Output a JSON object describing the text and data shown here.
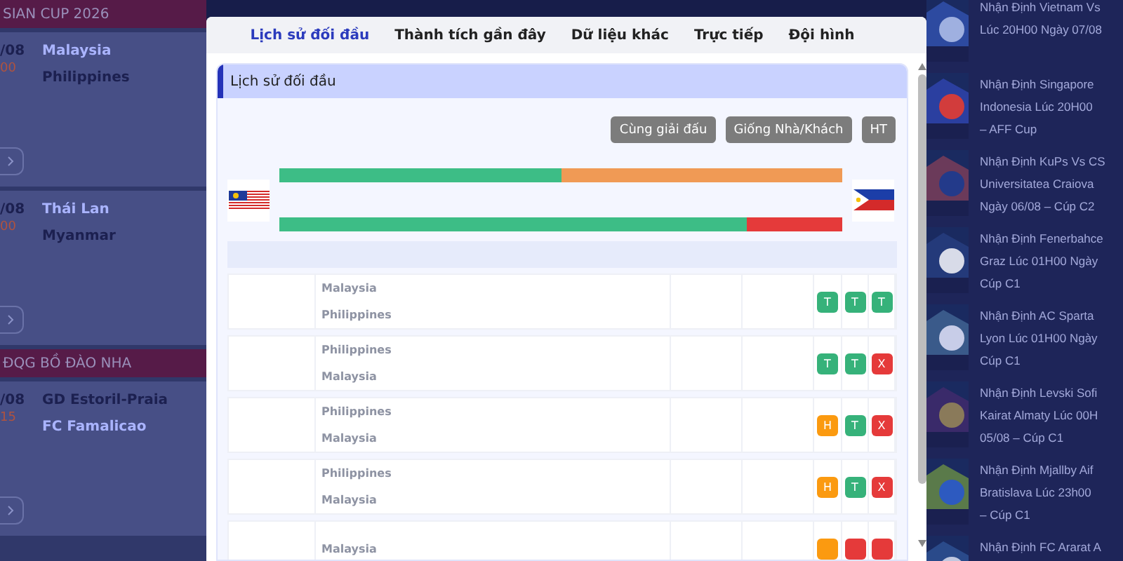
{
  "left_list": [
    {
      "heading": "SIAN CUP 2026",
      "matches": [
        {
          "date": "/08",
          "time": "00",
          "teams": [
            {
              "name": "Malaysia",
              "highlighted": true
            },
            {
              "name": "Philippines",
              "highlighted": false
            }
          ]
        },
        {
          "date": "/08",
          "time": "00",
          "teams": [
            {
              "name": "Thái Lan",
              "highlighted": true
            },
            {
              "name": "Myanmar",
              "highlighted": false
            }
          ]
        }
      ]
    },
    {
      "heading": "ĐQG BỒ ĐÀO NHA",
      "matches": [
        {
          "date": "/08",
          "time": "15",
          "teams": [
            {
              "name": "GD Estoril-Praia",
              "highlighted": false
            },
            {
              "name": "FC Famalicao",
              "highlighted": true
            }
          ]
        }
      ]
    }
  ],
  "modal": {
    "tabs": [
      {
        "label": "Lịch sử đối đầu",
        "selected": true
      },
      {
        "label": "Thành tích gần đây",
        "selected": false
      },
      {
        "label": "Dữ liệu khác",
        "selected": false
      },
      {
        "label": "Trực tiếp",
        "selected": false
      },
      {
        "label": "Đội hình",
        "selected": false
      }
    ],
    "section_title": "Lịch sử đối đầu",
    "filters": [
      "Cùng giải đấu",
      "Giống Nhà/Khách",
      "HT"
    ],
    "bars": [
      {
        "level": 0.5,
        "color": "#3dbd86",
        "rest": {
          "color": "#f09a55"
        }
      },
      {
        "level": 0.83,
        "color": "#3dbd86",
        "rest": {
          "color": "#e53a3a"
        }
      }
    ],
    "rows": [
      {
        "teams": [
          "Malaysia",
          "Philippines"
        ],
        "results": [
          {
            "text": "T",
            "color": "#36b27a"
          },
          {
            "text": "T",
            "color": "#36b27a"
          },
          {
            "text": "T",
            "color": "#36b27a"
          }
        ]
      },
      {
        "teams": [
          "Philippines",
          "Malaysia"
        ],
        "results": [
          {
            "text": "T",
            "color": "#36b27a"
          },
          {
            "text": "T",
            "color": "#36b27a"
          },
          {
            "text": "X",
            "color": "#e53a3a"
          }
        ]
      },
      {
        "teams": [
          "Philippines",
          "Malaysia"
        ],
        "results": [
          {
            "text": "H",
            "color": "#fb9a10"
          },
          {
            "text": "T",
            "color": "#36b27a"
          },
          {
            "text": "X",
            "color": "#e53a3a"
          }
        ]
      },
      {
        "teams": [
          "Philippines",
          "Malaysia"
        ],
        "results": [
          {
            "text": "H",
            "color": "#fb9a10"
          },
          {
            "text": "T",
            "color": "#36b27a"
          },
          {
            "text": "X",
            "color": "#e53a3a"
          }
        ]
      },
      {
        "teams": [
          "Malaysia"
        ],
        "results": [
          {
            "color": "#fb9a10"
          },
          {
            "color": "#e53a3a"
          },
          {
            "color": "#e53a3a"
          }
        ]
      }
    ]
  },
  "news": [
    {
      "lines": [
        "Nhận Định Vietnam Vs",
        "Lúc 20H00 Ngày 07/08"
      ]
    },
    {
      "lines": [
        "Nhận Định Singapore",
        "Indonesia Lúc 20H00",
        "– AFF Cup"
      ]
    },
    {
      "lines": [
        "Nhận Định KuPs Vs CS",
        "Universitatea Craiova",
        "Ngày 06/08 – Cúp C2"
      ]
    },
    {
      "lines": [
        "Nhận Định Fenerbahce",
        "Graz Lúc 01H00 Ngày",
        "Cúp C1"
      ]
    },
    {
      "lines": [
        "Nhận Định AC Sparta",
        "Lyon Lúc 01H00 Ngày",
        "Cúp C1"
      ]
    },
    {
      "lines": [
        "Nhận Định Levski Sofi",
        "Kairat Almaty Lúc 00H",
        "05/08 – Cúp C1"
      ]
    },
    {
      "lines": [
        "Nhận Định Mjallby Aif",
        "Bratislava Lúc 23h00",
        "– Cúp C1"
      ]
    },
    {
      "lines": [
        "Nhận Định FC Ararat A"
      ]
    }
  ]
}
